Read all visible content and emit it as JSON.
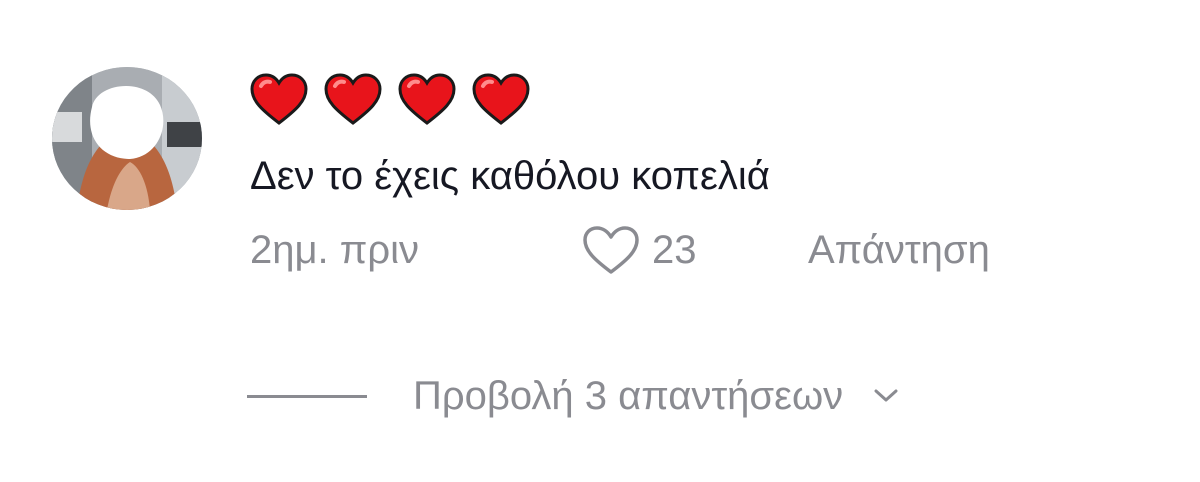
{
  "comment": {
    "emojis": [
      "heart-emoji",
      "heart-emoji",
      "heart-emoji",
      "heart-emoji"
    ],
    "text": "Δεν το έχεις καθόλου κοπελιά",
    "timestamp": "2ημ. πριν",
    "like_count": "23",
    "like_icon": "heart-outline-icon",
    "reply_label": "Απάντηση"
  },
  "replies": {
    "view_label": "Προβολή 3 απαντήσεων",
    "chevron_icon": "chevron-down-icon"
  },
  "colors": {
    "text": "#161823",
    "secondary": "#8a8b91",
    "emoji_heart": "#e8141b"
  }
}
